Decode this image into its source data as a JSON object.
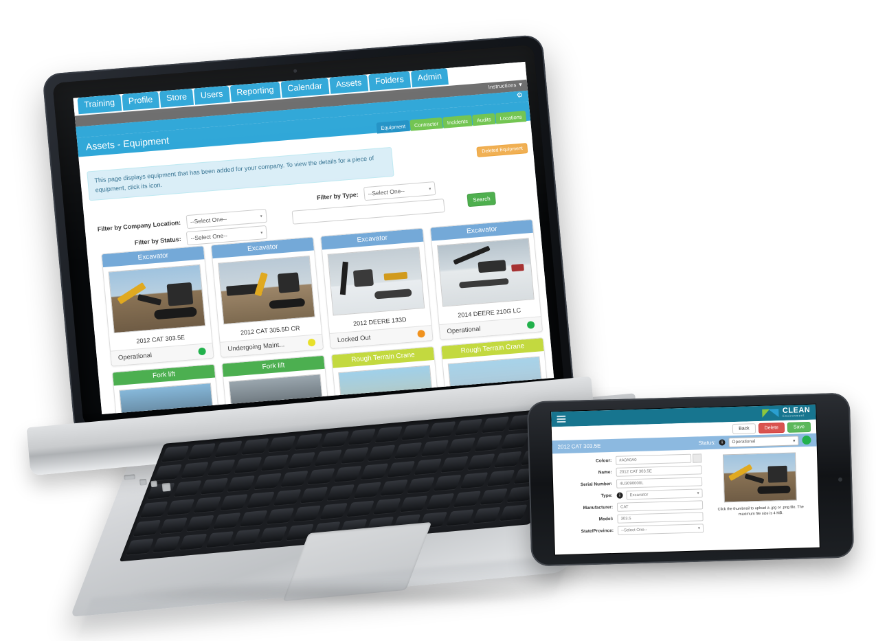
{
  "desktop": {
    "nav_tabs": [
      {
        "label": "Training"
      },
      {
        "label": "Profile"
      },
      {
        "label": "Store"
      },
      {
        "label": "Users"
      },
      {
        "label": "Reporting"
      },
      {
        "label": "Calendar"
      },
      {
        "label": "Assets"
      },
      {
        "label": "Folders"
      },
      {
        "label": "Admin"
      }
    ],
    "instructions_label": "Instructions",
    "instructions_caret": "▼",
    "gear_icon": "⚙",
    "page_title": "Assets - Equipment",
    "sub_tabs": [
      {
        "label": "Equipment",
        "active": true
      },
      {
        "label": "Contractor",
        "active": false
      },
      {
        "label": "Incidents",
        "active": false
      },
      {
        "label": "Audits",
        "active": false
      },
      {
        "label": "Locations",
        "active": false
      }
    ],
    "deleted_equipment_label": "Deleted Equipment",
    "info_text": "This page displays equipment that has been added for your company. To view the details for a piece of equipment, click its icon.",
    "filters": {
      "company_location_label": "Filter by Company Location:",
      "company_location_value": "--Select One--",
      "status_label": "Filter by Status:",
      "status_value": "--Select One--",
      "type_label": "Filter by Type:",
      "type_value": "--Select One--",
      "keyword_value": "",
      "search_button": "Search",
      "caret": "▾"
    },
    "cards": [
      {
        "type": "Excavator",
        "name": "2012 CAT 303.5E",
        "status": "Operational",
        "status_color": "#22b14c",
        "header_color": "#74a9d8"
      },
      {
        "type": "Excavator",
        "name": "2012 CAT 305.5D CR",
        "status": "Undergoing Maint...",
        "status_color": "#e8e02a",
        "header_color": "#74a9d8"
      },
      {
        "type": "Excavator",
        "name": "2012 DEERE 133D",
        "status": "Locked Out",
        "status_color": "#f0921e",
        "header_color": "#74a9d8"
      },
      {
        "type": "Excavator",
        "name": "2014 DEERE 210G LC",
        "status": "Operational",
        "status_color": "#22b14c",
        "header_color": "#74a9d8"
      }
    ],
    "cards_row2": [
      {
        "type": "Fork lift",
        "header_color": "#4caf50"
      },
      {
        "type": "Fork lift",
        "header_color": "#4caf50"
      },
      {
        "type": "Rough Terrain Crane",
        "header_color": "#c3d93f"
      },
      {
        "type": "Rough Terrain Crane",
        "header_color": "#c3d93f"
      }
    ]
  },
  "phone": {
    "menu_icon": "hamburger-icon",
    "brand_name": "CLEAN",
    "brand_sub": "Environment",
    "actions": [
      {
        "label": "Back",
        "style": "back"
      },
      {
        "label": "Delete",
        "style": "del"
      },
      {
        "label": "Save",
        "style": "save"
      }
    ],
    "record_title": "2012 CAT 303.5E",
    "status_label": "Status:",
    "status_value": "Operational",
    "status_color": "#22b14c",
    "info_icon": "i",
    "caret": "▾",
    "fields": [
      {
        "label": "Colour:",
        "value": "#A0A0A0",
        "type": "text"
      },
      {
        "label": "Name:",
        "value": "2012 CAT 303.5E",
        "type": "text"
      },
      {
        "label": "Serial Number:",
        "value": "4U3090000L",
        "type": "text"
      },
      {
        "label": "Type:",
        "value": "Excavator",
        "type": "select",
        "info": true
      },
      {
        "label": "Manufacturer:",
        "value": "CAT",
        "type": "text"
      },
      {
        "label": "Model:",
        "value": "303.5",
        "type": "text"
      },
      {
        "label": "State/Province:",
        "value": "--Select One--",
        "type": "select"
      }
    ],
    "upload_hint": "Click the thumbnail to upload a .jpg or .png file. The maximum file size is 4 MB."
  },
  "colors": {
    "accent_blue": "#26a3d6",
    "teal": "#17758f",
    "green": "#5cb85c",
    "red": "#d9534f",
    "orange": "#f0ad4e",
    "card_blue": "#74a9d8",
    "card_green": "#4caf50",
    "card_lime": "#c3d93f"
  }
}
